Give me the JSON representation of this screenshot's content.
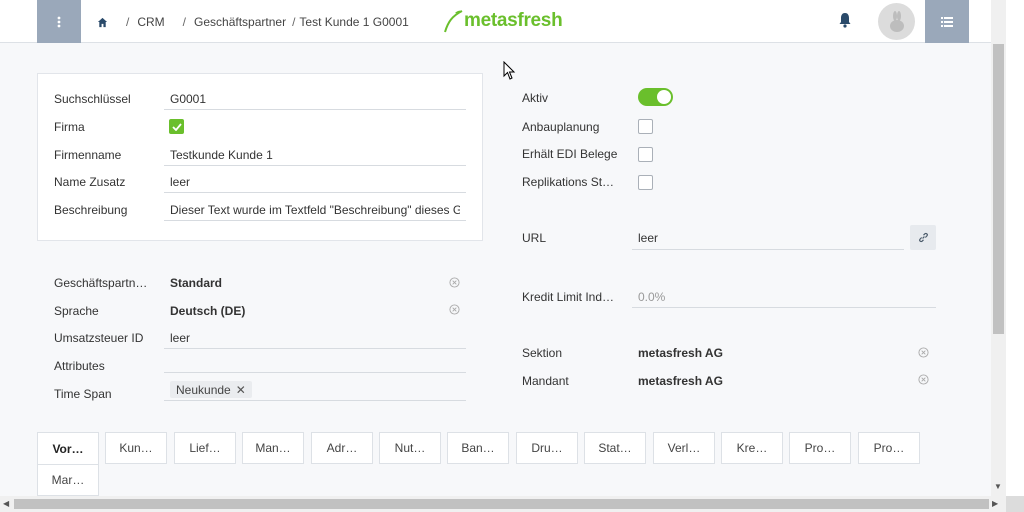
{
  "header": {
    "breadcrumb": [
      "CRM",
      "Geschäftspartner",
      "Test Kunde 1 G0001"
    ],
    "logo_text": "metasfresh",
    "accent": "#6abf2c",
    "menu_button_color": "#9aa8ba"
  },
  "left_card": {
    "fields": [
      {
        "label": "Suchschlüssel",
        "value": "G0001"
      },
      {
        "label": "Firma",
        "checked": true
      },
      {
        "label": "Firmenname",
        "value": "Testkunde Kunde 1"
      },
      {
        "label": "Name Zusatz",
        "value": "leer"
      },
      {
        "label": "Beschreibung",
        "value": "Dieser Text wurde im Textfeld \"Beschreibung\" dieses Gesch"
      }
    ]
  },
  "left_lower": {
    "fields": [
      {
        "label": "Geschäftspartn…",
        "value": "Standard"
      },
      {
        "label": "Sprache",
        "value": "Deutsch (DE)"
      },
      {
        "label": "Umsatzsteuer ID",
        "value": "leer"
      },
      {
        "label": "Attributes",
        "value": ""
      },
      {
        "label": "Time Span",
        "tag": "Neukunde"
      }
    ]
  },
  "right": {
    "flags": [
      {
        "label": "Aktiv",
        "on": true
      },
      {
        "label": "Anbauplanung",
        "checked": false
      },
      {
        "label": "Erhält EDI Belege",
        "checked": false
      },
      {
        "label": "Replikations St…",
        "checked": false
      }
    ],
    "url": {
      "label": "URL",
      "value": "leer"
    },
    "credit": {
      "label": "Kredit Limit Ind…",
      "value": "0.0%"
    },
    "sektion": {
      "label": "Sektion",
      "value": "metasfresh AG"
    },
    "mandant": {
      "label": "Mandant",
      "value": "metasfresh AG"
    }
  },
  "tabs": [
    "Vor…",
    "Kun…",
    "Lief…",
    "Man…",
    "Adr…",
    "Nut…",
    "Ban…",
    "Dru…",
    "Stat…",
    "Verl…",
    "Kre…",
    "Pro…",
    "Pro…",
    "Mar…"
  ]
}
